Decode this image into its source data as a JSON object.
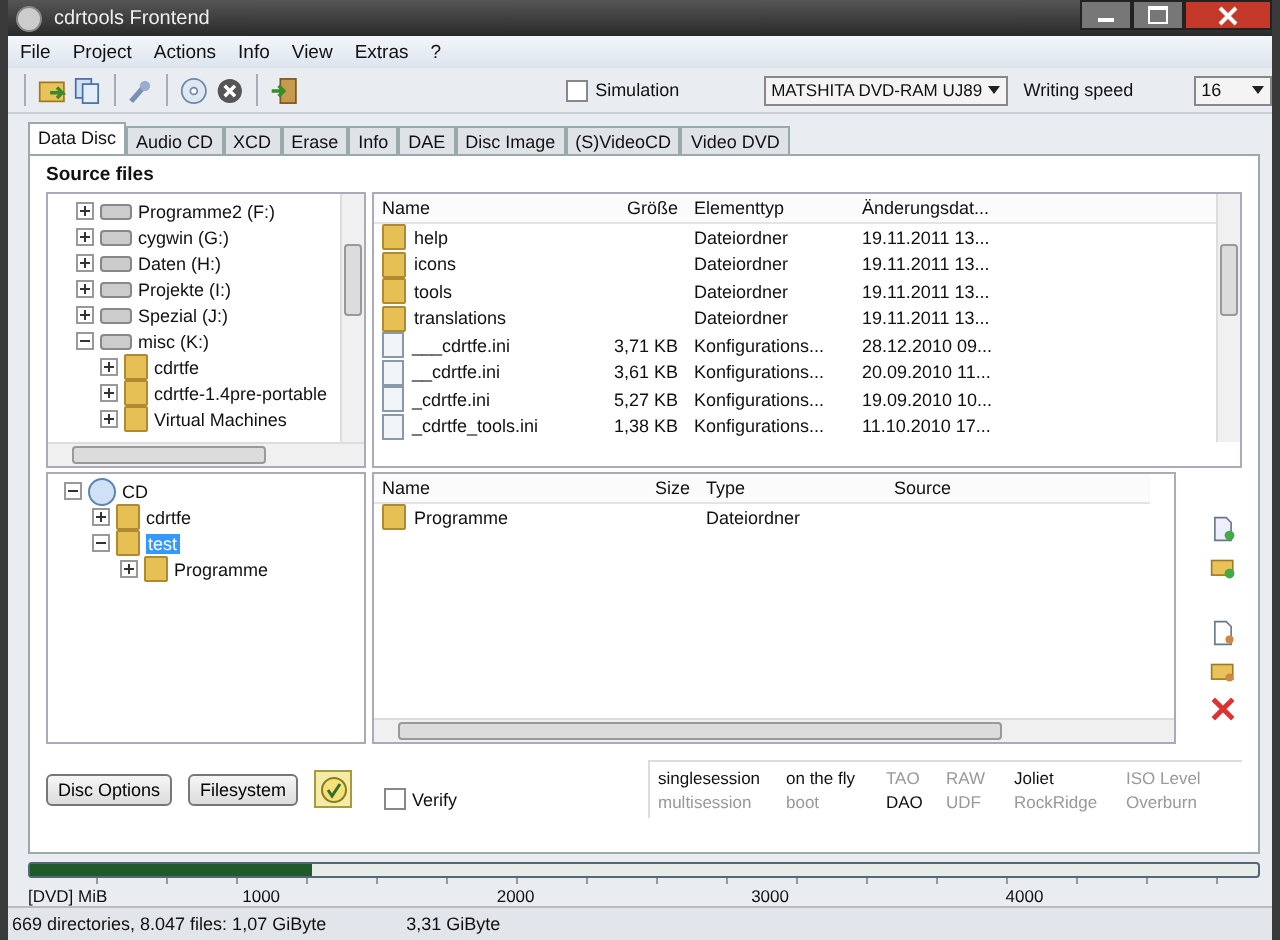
{
  "window": {
    "title": "cdrtools Frontend"
  },
  "menu": [
    "File",
    "Project",
    "Actions",
    "Info",
    "View",
    "Extras",
    "?"
  ],
  "toolbar": {
    "simulation": {
      "label": "Simulation",
      "checked": false
    },
    "drive": "MATSHITA DVD-RAM UJ89",
    "speed_label": "Writing speed",
    "speed": "16"
  },
  "tabs": [
    {
      "label": "Data Disc",
      "selected": true
    },
    {
      "label": "Audio CD",
      "selected": false
    },
    {
      "label": "XCD",
      "selected": false
    },
    {
      "label": "Erase",
      "selected": false
    },
    {
      "label": "Info",
      "selected": false
    },
    {
      "label": "DAE",
      "selected": false
    },
    {
      "label": "Disc Image",
      "selected": false
    },
    {
      "label": "(S)VideoCD",
      "selected": false
    },
    {
      "label": "Video DVD",
      "selected": false
    }
  ],
  "source_heading": "Source files",
  "source_tree": [
    {
      "label": "Programme2 (F:)",
      "kind": "drive",
      "expanded": false,
      "selected": false
    },
    {
      "label": "cygwin (G:)",
      "kind": "drive",
      "expanded": false,
      "selected": false
    },
    {
      "label": "Daten (H:)",
      "kind": "drive",
      "expanded": false,
      "selected": false
    },
    {
      "label": "Projekte (I:)",
      "kind": "drive",
      "expanded": false,
      "selected": false
    },
    {
      "label": "Spezial (J:)",
      "kind": "drive",
      "expanded": false,
      "selected": false
    },
    {
      "label": "misc (K:)",
      "kind": "drive",
      "expanded": true,
      "selected": false,
      "children": [
        {
          "label": "cdrtfe",
          "kind": "folder",
          "expanded": false,
          "selected": false
        },
        {
          "label": "cdrtfe-1.4pre-portable",
          "kind": "folder",
          "expanded": false,
          "selected": false
        },
        {
          "label": "Virtual Machines",
          "kind": "folder",
          "expanded": false,
          "selected": false
        }
      ]
    }
  ],
  "source_list": {
    "columns": [
      "Name",
      "Größe",
      "Elementtyp",
      "Änderungsdat..."
    ],
    "rows": [
      {
        "kind": "folder",
        "cells": [
          "help",
          "",
          "Dateiordner",
          "19.11.2011 13..."
        ]
      },
      {
        "kind": "folder",
        "cells": [
          "icons",
          "",
          "Dateiordner",
          "19.11.2011 13..."
        ]
      },
      {
        "kind": "folder",
        "cells": [
          "tools",
          "",
          "Dateiordner",
          "19.11.2011 13..."
        ]
      },
      {
        "kind": "folder",
        "cells": [
          "translations",
          "",
          "Dateiordner",
          "19.11.2011 13..."
        ]
      },
      {
        "kind": "file",
        "cells": [
          "___cdrtfe.ini",
          "3,71 KB",
          "Konfigurations...",
          "28.12.2010 09..."
        ]
      },
      {
        "kind": "file",
        "cells": [
          "__cdrtfe.ini",
          "3,61 KB",
          "Konfigurations...",
          "20.09.2010 11..."
        ]
      },
      {
        "kind": "file",
        "cells": [
          "_cdrtfe.ini",
          "5,27 KB",
          "Konfigurations...",
          "19.09.2010 10..."
        ]
      },
      {
        "kind": "file",
        "cells": [
          "_cdrtfe_tools.ini",
          "1,38 KB",
          "Konfigurations...",
          "11.10.2010 17..."
        ]
      }
    ]
  },
  "disc_tree": [
    {
      "label": "CD",
      "kind": "disc",
      "expanded": true,
      "selected": false,
      "children": [
        {
          "label": "cdrtfe",
          "kind": "folder",
          "expanded": false,
          "selected": false
        },
        {
          "label": "test",
          "kind": "folder",
          "expanded": true,
          "selected": true,
          "children": [
            {
              "label": "Programme",
              "kind": "folder",
              "expanded": false,
              "selected": false
            }
          ]
        }
      ]
    }
  ],
  "disc_list": {
    "columns": [
      "Name",
      "Size",
      "Type",
      "Source"
    ],
    "rows": [
      {
        "kind": "folder",
        "cells": [
          "Programme",
          "",
          "Dateiordner",
          ""
        ]
      }
    ]
  },
  "buttons": [
    "Disc Options",
    "Filesystem"
  ],
  "verify": {
    "label": "Verify",
    "checked": false
  },
  "flags": [
    {
      "label": "singlesession",
      "active": true
    },
    {
      "label": "on the fly",
      "active": true
    },
    {
      "label": "TAO",
      "active": false
    },
    {
      "label": "RAW",
      "active": false
    },
    {
      "label": "Joliet",
      "active": true
    },
    {
      "label": "ISO Level",
      "active": false
    },
    {
      "label": "multisession",
      "active": false
    },
    {
      "label": "boot",
      "active": false
    },
    {
      "label": "DAO",
      "active": true
    },
    {
      "label": "UDF",
      "active": false
    },
    {
      "label": "RockRidge",
      "active": false
    },
    {
      "label": "Overburn",
      "active": false
    }
  ],
  "capacity": {
    "level": 0.23,
    "unit": "[DVD] MiB",
    "ticks": [
      "1000",
      "2000",
      "3000",
      "4000"
    ]
  },
  "status_bar": [
    "669 directories, 8.047 files: 1,07 GiByte",
    "3,31 GiByte"
  ]
}
